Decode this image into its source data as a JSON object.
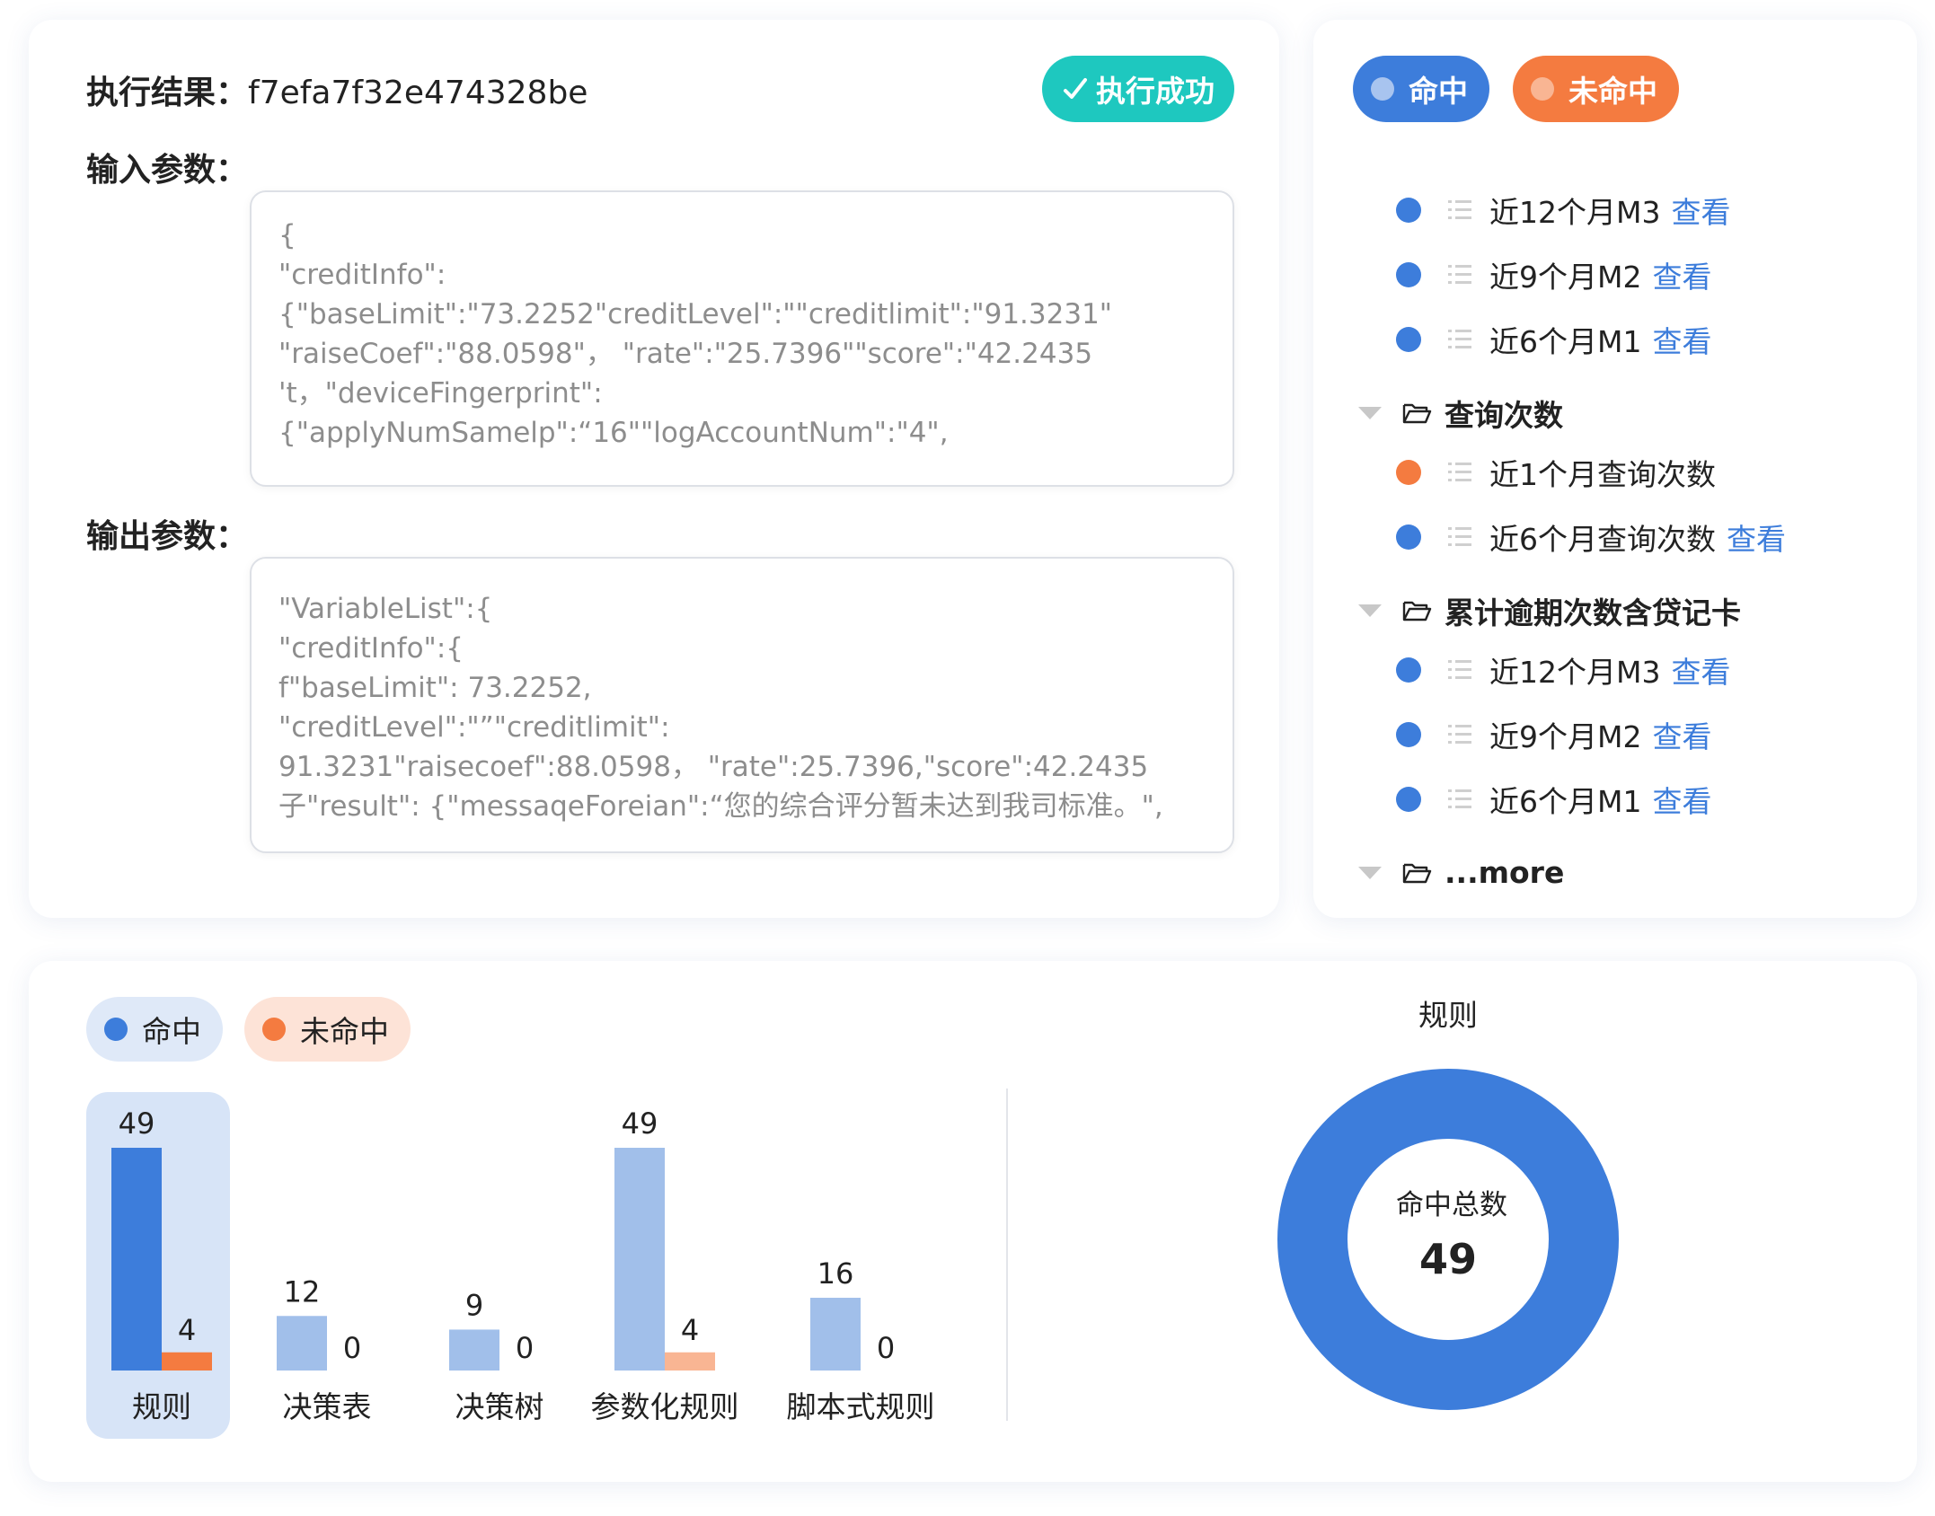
{
  "colors": {
    "hit": "#3d7ddb",
    "hit_light": "#a1bfea",
    "miss": "#f47b40",
    "miss_light": "#f9b593",
    "success": "#1ec8bf",
    "link": "#3d7ddb"
  },
  "exec": {
    "result_label": "执行结果：",
    "result_id": "f7efa7f32e474328be",
    "status_badge": "执行成功",
    "status_icon": "check-icon",
    "input_label": "输入参数：",
    "input_lines": [
      "{",
      "\"creditInfo\":",
      "{\"baseLimit\":\"73.2252\"creditLevel\":\"\"creditlimit\":\"91.3231\"",
      "\"raiseCoef\":\"88.0598\"， \"rate\":\"25.7396\"\"score\":\"42.2435",
      "'t，\"deviceFingerprint\":",
      "{\"applyNumSamelp\":“16\"\"logAccountNum\":\"4\","
    ],
    "output_label": "输出参数：",
    "output_lines": [
      "\"VariableList\":{",
      "\"creditInfo\":{",
      "f\"baseLimit\": 73.2252,",
      "\"creditLevel\":\"”\"creditlimit\":",
      "91.3231\"raisecoef\":88.0598， \"rate\":25.7396,\"score\":42.2435",
      "子\"result\": {\"messaqeForeian\":“您的综合评分暂未达到我司标准。\","
    ]
  },
  "legend": {
    "hit": "命中",
    "miss": "未命中"
  },
  "tree": {
    "items": [
      {
        "kind": "leaf",
        "status": "hit",
        "label": "近12个月M3",
        "link": "查看"
      },
      {
        "kind": "leaf",
        "status": "hit",
        "label": "近9个月M2",
        "link": "查看"
      },
      {
        "kind": "leaf",
        "status": "hit",
        "label": "近6个月M1",
        "link": "查看"
      },
      {
        "kind": "group",
        "label": "查询次数"
      },
      {
        "kind": "leaf",
        "status": "miss",
        "label": "近1个月查询次数",
        "link": ""
      },
      {
        "kind": "leaf",
        "status": "hit",
        "label": "近6个月查询次数",
        "link": "查看"
      },
      {
        "kind": "group",
        "label": "累计逾期次数含贷记卡"
      },
      {
        "kind": "leaf",
        "status": "hit",
        "label": "近12个月M3",
        "link": "查看"
      },
      {
        "kind": "leaf",
        "status": "hit",
        "label": "近9个月M2",
        "link": "查看"
      },
      {
        "kind": "leaf",
        "status": "hit",
        "label": "近6个月M1",
        "link": "查看"
      },
      {
        "kind": "group",
        "label": "...more"
      }
    ]
  },
  "chart_data": [
    {
      "type": "bar",
      "categories": [
        "规则",
        "决策表",
        "决策树",
        "参数化规则",
        "脚本式规则"
      ],
      "series": [
        {
          "name": "命中",
          "values": [
            49,
            12,
            9,
            49,
            16
          ]
        },
        {
          "name": "未命中",
          "values": [
            4,
            0,
            0,
            4,
            0
          ]
        }
      ],
      "selected_category": "规则",
      "ylim": [
        0,
        49
      ]
    },
    {
      "type": "pie",
      "title": "规则",
      "center_label": "命中总数",
      "center_value": "49",
      "slices": [
        {
          "name": "命中",
          "value": 49
        },
        {
          "name": "未命中",
          "value": 0
        }
      ]
    }
  ]
}
